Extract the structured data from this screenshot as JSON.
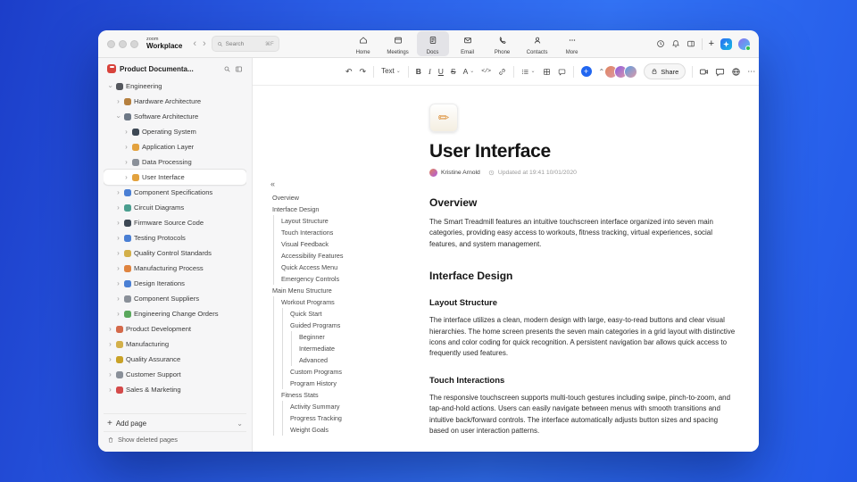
{
  "titlebar": {
    "logo_top": "zoom",
    "logo_bottom": "Workplace",
    "search": {
      "placeholder": "Search",
      "shortcut": "⌘F"
    },
    "tabs": [
      {
        "label": "Home",
        "icon": "home-icon",
        "active": false
      },
      {
        "label": "Meetings",
        "icon": "meetings-icon",
        "active": false
      },
      {
        "label": "Docs",
        "icon": "docs-icon",
        "active": true
      },
      {
        "label": "Email",
        "icon": "email-icon",
        "active": false
      },
      {
        "label": "Phone",
        "icon": "phone-icon",
        "active": false
      },
      {
        "label": "Contacts",
        "icon": "contacts-icon",
        "active": false
      },
      {
        "label": "More",
        "icon": "more-icon",
        "active": false
      }
    ]
  },
  "sidebar": {
    "workspace_title": "Product Documenta...",
    "items": [
      {
        "label": "Engineering",
        "level": 0,
        "color": "#55585e",
        "expanded": true,
        "selected": false
      },
      {
        "label": "Hardware Architecture",
        "level": 1,
        "color": "#b5803f",
        "expanded": false,
        "selected": false
      },
      {
        "label": "Software Architecture",
        "level": 1,
        "color": "#6d7886",
        "expanded": true,
        "selected": false
      },
      {
        "label": "Operating System",
        "level": 2,
        "color": "#3d4854",
        "expanded": false,
        "selected": false
      },
      {
        "label": "Application Layer",
        "level": 2,
        "color": "#e3a23e",
        "expanded": false,
        "selected": false
      },
      {
        "label": "Data Processing",
        "level": 2,
        "color": "#8a9099",
        "expanded": false,
        "selected": false
      },
      {
        "label": "User Interface",
        "level": 2,
        "color": "#e3a23e",
        "expanded": false,
        "selected": true
      },
      {
        "label": "Component Specifications",
        "level": 1,
        "color": "#4a7fd4",
        "expanded": false,
        "selected": false
      },
      {
        "label": "Circuit Diagrams",
        "level": 1,
        "color": "#4a9e8f",
        "expanded": false,
        "selected": false
      },
      {
        "label": "Firmware Source Code",
        "level": 1,
        "color": "#3d4854",
        "expanded": false,
        "selected": false
      },
      {
        "label": "Testing Protocols",
        "level": 1,
        "color": "#4a7fd4",
        "expanded": false,
        "selected": false
      },
      {
        "label": "Quality Control Standards",
        "level": 1,
        "color": "#d3b04a",
        "expanded": false,
        "selected": false
      },
      {
        "label": "Manufacturing Process",
        "level": 1,
        "color": "#df8440",
        "expanded": false,
        "selected": false
      },
      {
        "label": "Design Iterations",
        "level": 1,
        "color": "#4a7fd4",
        "expanded": false,
        "selected": false
      },
      {
        "label": "Component Suppliers",
        "level": 1,
        "color": "#8a9099",
        "expanded": false,
        "selected": false
      },
      {
        "label": "Engineering Change Orders",
        "level": 1,
        "color": "#5aa85c",
        "expanded": false,
        "selected": false
      },
      {
        "label": "Product Development",
        "level": 0,
        "color": "#d4694a",
        "expanded": false,
        "selected": false
      },
      {
        "label": "Manufacturing",
        "level": 0,
        "color": "#d3b04a",
        "expanded": false,
        "selected": false
      },
      {
        "label": "Quality Assurance",
        "level": 0,
        "color": "#c9a227",
        "expanded": false,
        "selected": false
      },
      {
        "label": "Customer Support",
        "level": 0,
        "color": "#8a9099",
        "expanded": false,
        "selected": false
      },
      {
        "label": "Sales & Marketing",
        "level": 0,
        "color": "#d44a4a",
        "expanded": false,
        "selected": false
      }
    ],
    "add_page_label": "Add page",
    "show_deleted_label": "Show deleted pages"
  },
  "doc_toolbar": {
    "text_style_label": "Text",
    "bold_label": "B",
    "italic_label": "I",
    "underline_label": "U",
    "strikethrough_label": "S",
    "text_color_label": "A",
    "code_label": "</>",
    "share_label": "Share",
    "collaborators": [
      "#e0845a",
      "#8a5ae0",
      "#5a9ee0"
    ]
  },
  "outline": {
    "collapse_glyph": "«",
    "items": [
      {
        "label": "Overview",
        "level": 0
      },
      {
        "label": "Interface Design",
        "level": 0
      },
      {
        "label": "Layout Structure",
        "level": 1
      },
      {
        "label": "Touch Interactions",
        "level": 1
      },
      {
        "label": "Visual Feedback",
        "level": 1
      },
      {
        "label": "Accessibility Features",
        "level": 1
      },
      {
        "label": "Quick Access Menu",
        "level": 1
      },
      {
        "label": "Emergency Controls",
        "level": 1
      },
      {
        "label": "Main Menu Structure",
        "level": 0
      },
      {
        "label": "Workout Programs",
        "level": 1
      },
      {
        "label": "Quick Start",
        "level": 2
      },
      {
        "label": "Guided Programs",
        "level": 2
      },
      {
        "label": "Beginner",
        "level": 3
      },
      {
        "label": "Intermediate",
        "level": 3
      },
      {
        "label": "Advanced",
        "level": 3
      },
      {
        "label": "Custom Programs",
        "level": 2
      },
      {
        "label": "Program History",
        "level": 2
      },
      {
        "label": "Fitness Stats",
        "level": 1
      },
      {
        "label": "Activity Summary",
        "level": 2
      },
      {
        "label": "Progress Tracking",
        "level": 2
      },
      {
        "label": "Weight Goals",
        "level": 2
      }
    ]
  },
  "doc": {
    "title": "User Interface",
    "author": "Kristine Arnold",
    "updated": "Updated at 19:41 10/01/2020",
    "blocks": [
      {
        "type": "h2",
        "text": "Overview"
      },
      {
        "type": "p",
        "text": "The Smart Treadmill features an intuitive touchscreen interface organized into seven main categories, providing easy access to workouts, fitness tracking, virtual experiences, social features, and system management."
      },
      {
        "type": "h2",
        "text": "Interface Design"
      },
      {
        "type": "h3",
        "text": "Layout Structure"
      },
      {
        "type": "p",
        "text": "The interface utilizes a clean, modern design with large, easy-to-read buttons and clear visual hierarchies. The home screen presents the seven main categories in a grid layout with distinctive icons and color coding for quick recognition. A persistent navigation bar allows quick access to frequently used features."
      },
      {
        "type": "h3",
        "text": "Touch Interactions"
      },
      {
        "type": "p",
        "text": "The responsive touchscreen supports multi-touch gestures including swipe, pinch-to-zoom, and tap-and-hold actions. Users can easily navigate between menus with smooth transitions and intuitive back/forward controls. The interface automatically adjusts button sizes and spacing based on user interaction patterns."
      }
    ]
  }
}
